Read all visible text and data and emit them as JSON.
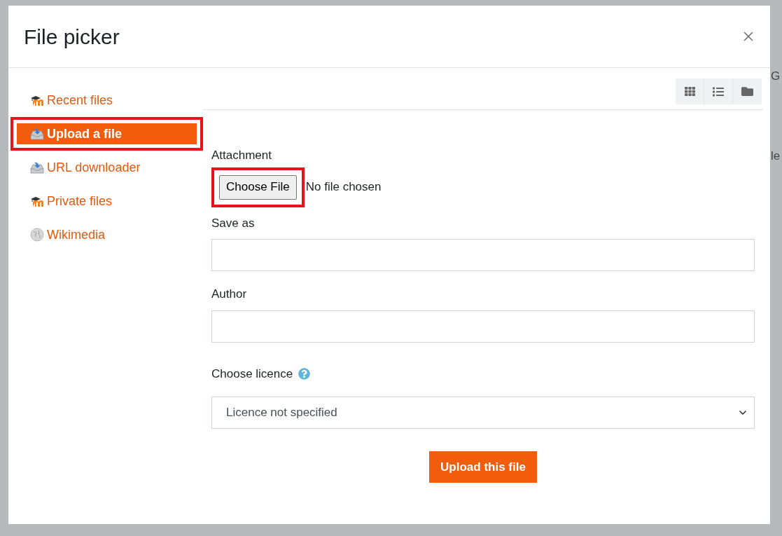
{
  "background_text": [
    "G",
    "le"
  ],
  "dialog": {
    "title": "File picker",
    "sidebar": [
      {
        "label": "Recent files",
        "kind": "moodle",
        "selected": false,
        "highlighted": false
      },
      {
        "label": "Upload a file",
        "kind": "upload",
        "selected": true,
        "highlighted": true
      },
      {
        "label": "URL downloader",
        "kind": "upload",
        "selected": false,
        "highlighted": false
      },
      {
        "label": "Private files",
        "kind": "moodle",
        "selected": false,
        "highlighted": false
      },
      {
        "label": "Wikimedia",
        "kind": "globe",
        "selected": false,
        "highlighted": false
      }
    ],
    "form": {
      "attachment": {
        "label": "Attachment",
        "button": "Choose File",
        "status": "No file chosen",
        "highlighted": true
      },
      "save_as": {
        "label": "Save as"
      },
      "author": {
        "label": "Author"
      },
      "licence": {
        "label": "Choose licence",
        "value": "Licence not specified"
      },
      "submit": "Upload this file"
    }
  }
}
